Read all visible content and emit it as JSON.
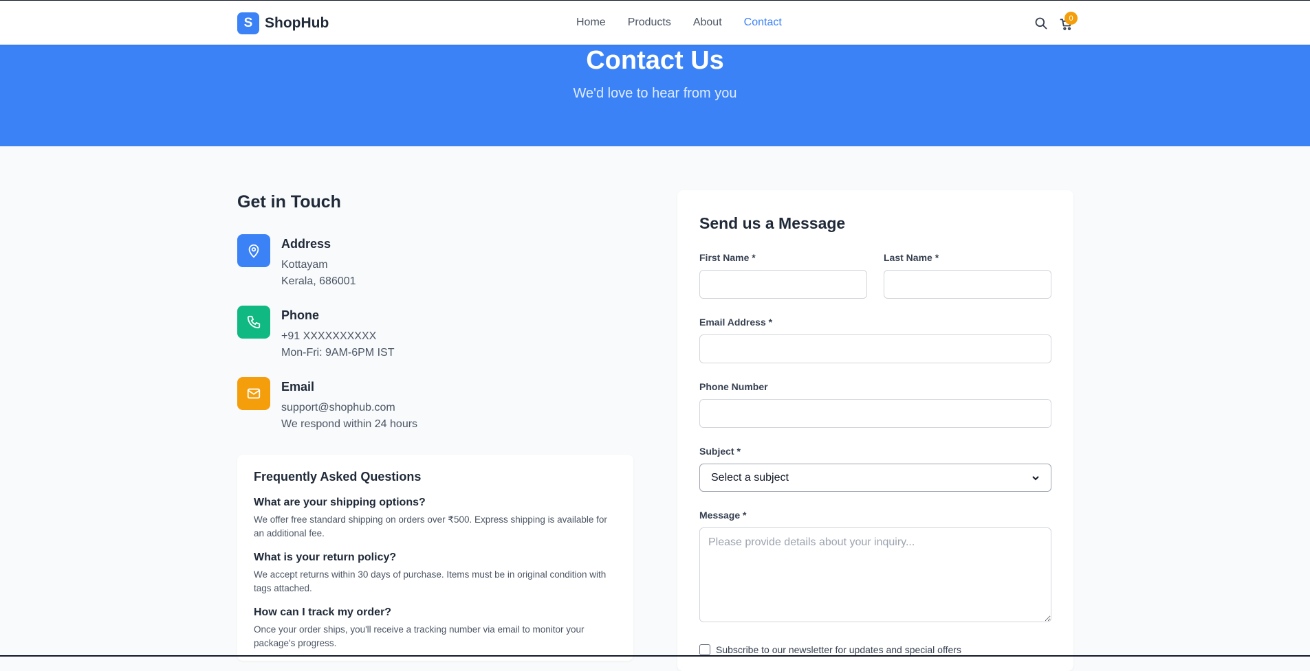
{
  "header": {
    "logo_letter": "S",
    "brand": "ShopHub",
    "nav": [
      "Home",
      "Products",
      "About",
      "Contact"
    ],
    "active_nav": "Contact",
    "cart_count": "0"
  },
  "hero": {
    "title": "Contact Us",
    "subtitle": "We'd love to hear from you"
  },
  "get_in_touch": {
    "title": "Get in Touch",
    "items": [
      {
        "title": "Address",
        "lines": [
          "Kottayam",
          "Kerala, 686001"
        ],
        "color": "#3b82f6",
        "icon": "map-pin-icon"
      },
      {
        "title": "Phone",
        "lines": [
          "+91 XXXXXXXXXX",
          "Mon-Fri: 9AM-6PM IST"
        ],
        "color": "#10b981",
        "icon": "phone-icon"
      },
      {
        "title": "Email",
        "lines": [
          "support@shophub.com",
          "We respond within 24 hours"
        ],
        "color": "#f59e0b",
        "icon": "mail-icon"
      }
    ]
  },
  "faq": {
    "title": "Frequently Asked Questions",
    "items": [
      {
        "q": "What are your shipping options?",
        "a": "We offer free standard shipping on orders over ₹500. Express shipping is available for an additional fee."
      },
      {
        "q": "What is your return policy?",
        "a": "We accept returns within 30 days of purchase. Items must be in original condition with tags attached."
      },
      {
        "q": "How can I track my order?",
        "a": "Once your order ships, you'll receive a tracking number via email to monitor your package's progress."
      }
    ]
  },
  "form": {
    "title": "Send us a Message",
    "first_name_label": "First Name *",
    "last_name_label": "Last Name *",
    "email_label": "Email Address *",
    "phone_label": "Phone Number",
    "subject_label": "Subject *",
    "subject_value": "Select a subject",
    "message_label": "Message *",
    "message_placeholder": "Please provide details about your inquiry...",
    "newsletter_label": "Subscribe to our newsletter for updates and special offers"
  }
}
